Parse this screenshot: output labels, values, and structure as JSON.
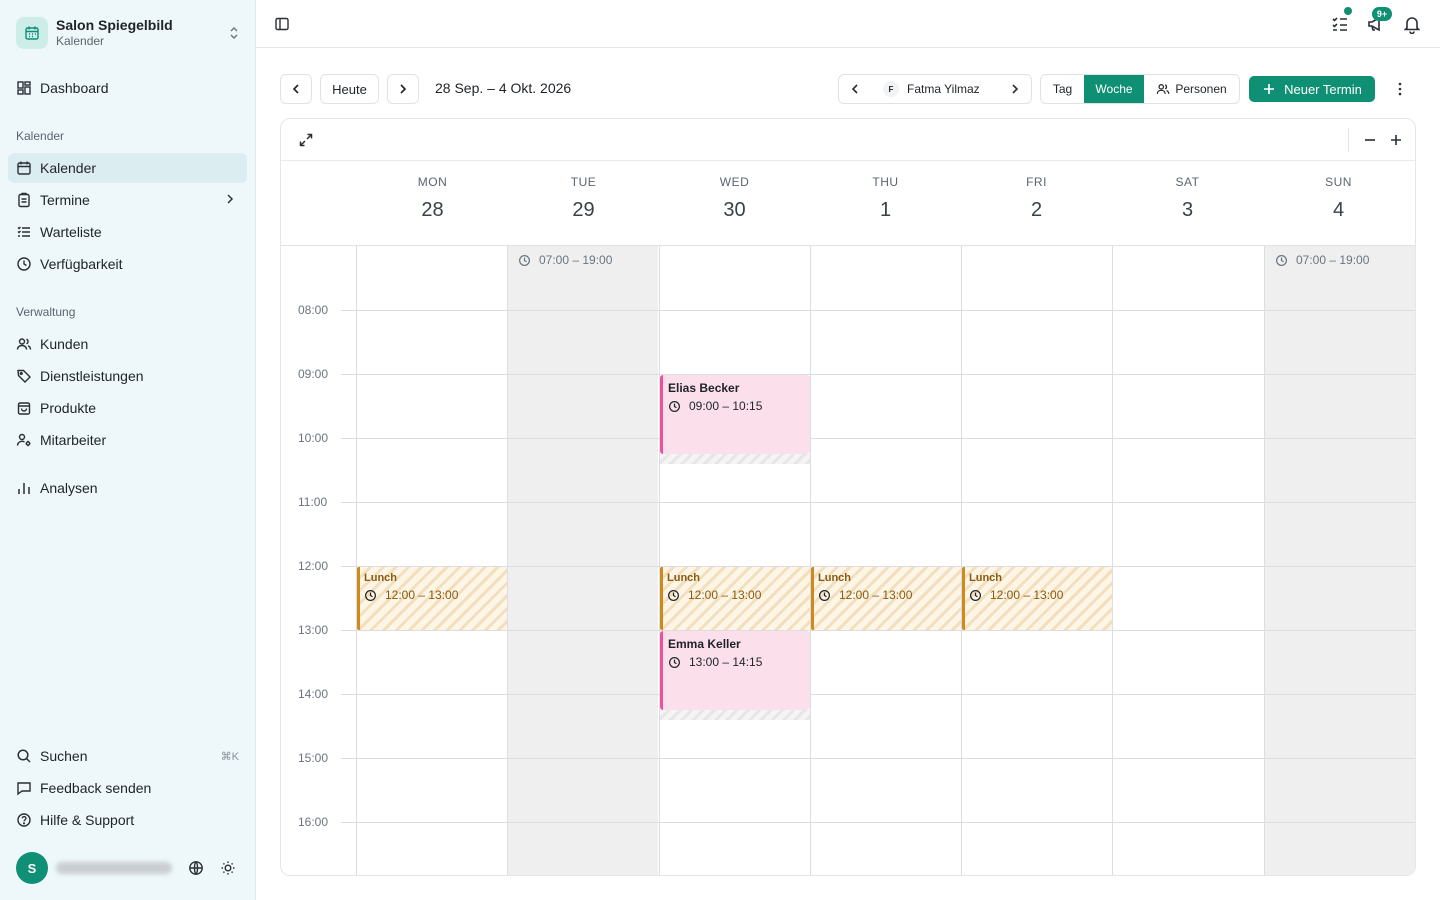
{
  "sidebar": {
    "brand": {
      "name": "Salon Spiegelbild",
      "sub": "Kalender"
    },
    "dashboard": "Dashboard",
    "section_calendar": "Kalender",
    "items_calendar": [
      {
        "label": "Kalender",
        "icon": "calendar-icon",
        "active": true
      },
      {
        "label": "Termine",
        "icon": "clipboard-icon"
      },
      {
        "label": "Warteliste",
        "icon": "list-icon"
      },
      {
        "label": "Verfügbarkeit",
        "icon": "clock-icon"
      }
    ],
    "section_admin": "Verwaltung",
    "items_admin": [
      {
        "label": "Kunden",
        "icon": "users-icon"
      },
      {
        "label": "Dienstleistungen",
        "icon": "tag-icon"
      },
      {
        "label": "Produkte",
        "icon": "bag-icon"
      },
      {
        "label": "Mitarbeiter",
        "icon": "user-gear-icon"
      }
    ],
    "analytics": "Analysen",
    "search": {
      "label": "Suchen",
      "shortcut": "⌘K"
    },
    "feedback": "Feedback senden",
    "help": "Hilfe & Support",
    "user": {
      "initial": "S"
    }
  },
  "topbar": {
    "badge_count": "9+"
  },
  "toolbar": {
    "today": "Heute",
    "date_range": "28 Sep. – 4 Okt. 2026",
    "staff": {
      "initial": "F",
      "name": "Fatma Yilmaz"
    },
    "views": [
      "Tag",
      "Woche",
      "Personen"
    ],
    "active_view": "Woche",
    "new_appointment": "Neuer Termin"
  },
  "calendar": {
    "days": [
      {
        "name": "MON",
        "num": "28"
      },
      {
        "name": "TUE",
        "num": "29"
      },
      {
        "name": "WED",
        "num": "30"
      },
      {
        "name": "THU",
        "num": "1"
      },
      {
        "name": "FRI",
        "num": "2"
      },
      {
        "name": "SAT",
        "num": "3"
      },
      {
        "name": "SUN",
        "num": "4"
      }
    ],
    "times": [
      "08:00",
      "09:00",
      "10:00",
      "11:00",
      "12:00",
      "13:00",
      "14:00",
      "15:00",
      "16:00"
    ],
    "closed_hint": "07:00 – 19:00",
    "events": {
      "elias": {
        "title": "Elias Becker",
        "time": "09:00 – 10:15"
      },
      "emma": {
        "title": "Emma Keller",
        "time": "13:00 – 14:15"
      },
      "lunch": {
        "title": "Lunch",
        "time": "12:00 – 13:00"
      }
    }
  },
  "colors": {
    "accent": "#0f8f74",
    "appointment": "#e8549b",
    "lunch": "#d08a1a",
    "sidebar_bg": "#eef7f9"
  }
}
